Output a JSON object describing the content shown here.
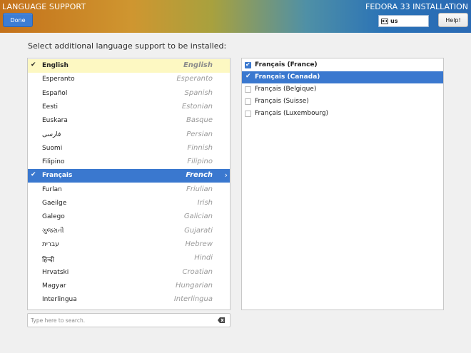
{
  "header": {
    "title": "LANGUAGE SUPPORT",
    "done_label": "Done",
    "install_title": "FEDORA 33 INSTALLATION",
    "keyboard_layout": "us",
    "help_label": "Help!"
  },
  "prompt": "Select additional language support to be installed:",
  "languages": [
    {
      "native": "English",
      "english": "English",
      "checked": true,
      "state": "highlight"
    },
    {
      "native": "Esperanto",
      "english": "Esperanto"
    },
    {
      "native": "Español",
      "english": "Spanish"
    },
    {
      "native": "Eesti",
      "english": "Estonian"
    },
    {
      "native": "Euskara",
      "english": "Basque"
    },
    {
      "native": "فارسی",
      "english": "Persian"
    },
    {
      "native": "Suomi",
      "english": "Finnish"
    },
    {
      "native": "Filipino",
      "english": "Filipino"
    },
    {
      "native": "Français",
      "english": "French",
      "checked": true,
      "state": "selected"
    },
    {
      "native": "Furlan",
      "english": "Friulian"
    },
    {
      "native": "Gaeilge",
      "english": "Irish"
    },
    {
      "native": "Galego",
      "english": "Galician"
    },
    {
      "native": "ગુજરાતી",
      "english": "Gujarati"
    },
    {
      "native": "עברית",
      "english": "Hebrew"
    },
    {
      "native": "हिन्दी",
      "english": "Hindi"
    },
    {
      "native": "Hrvatski",
      "english": "Croatian"
    },
    {
      "native": "Magyar",
      "english": "Hungarian"
    },
    {
      "native": "Interlingua",
      "english": "Interlingua"
    }
  ],
  "locales": [
    {
      "label": "Français (France)",
      "checked": true,
      "state": "bold"
    },
    {
      "label": "Français (Canada)",
      "checked": true,
      "state": "selected"
    },
    {
      "label": "Français (Belgique)",
      "checked": false
    },
    {
      "label": "Français (Suisse)",
      "checked": false
    },
    {
      "label": "Français (Luxembourg)",
      "checked": false
    }
  ],
  "search": {
    "placeholder": "Type here to search.",
    "value": ""
  },
  "icons": {
    "check": "check-icon",
    "arrow": "chevron-right-icon",
    "keyboard": "keyboard-icon",
    "clear": "clear-search-icon"
  },
  "colors": {
    "selection": "#3a78cf",
    "highlight": "#fdf8c2",
    "done_button": "#3c7dd4"
  }
}
